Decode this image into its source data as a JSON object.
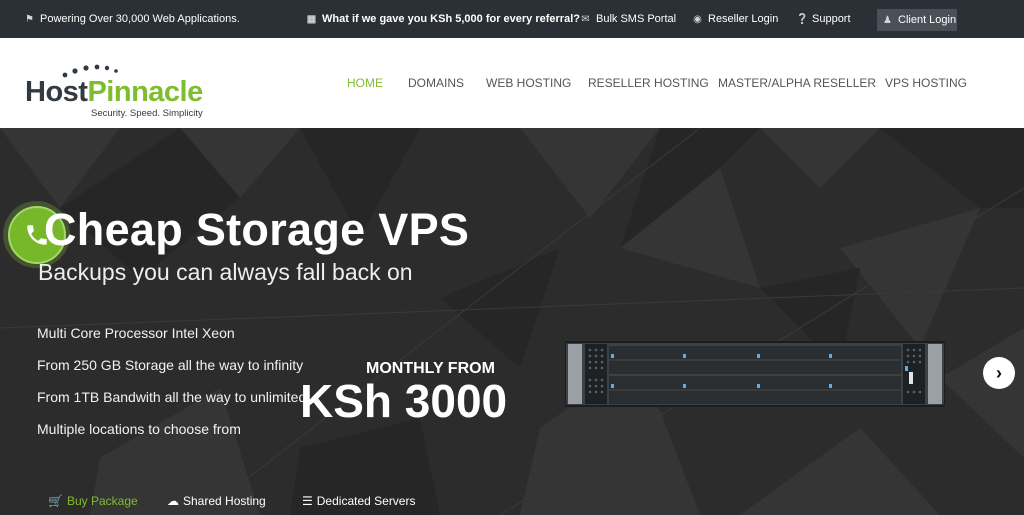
{
  "topbar": {
    "powering": "Powering Over 30,000 Web Applications.",
    "referral": "What if we gave you KSh 5,000 for every referral?",
    "sms": "Bulk SMS Portal",
    "reseller_login": "Reseller Login",
    "support": "Support",
    "client_login": "Client Login"
  },
  "logo": {
    "host": "Host",
    "pinnacle": "Pinnacle",
    "tagline": "Security. Speed. Simplicity"
  },
  "nav": [
    "HOME",
    "DOMAINS",
    "WEB HOSTING",
    "RESELLER HOSTING",
    "MASTER/ALPHA RESELLER",
    "VPS HOSTING"
  ],
  "hero": {
    "title": "Cheap Storage VPS",
    "subtitle": "Backups you can always fall back on",
    "features": [
      "Multi Core Processor Intel Xeon",
      "From 250 GB Storage all the way to infinity",
      "From 1TB Bandwith all the way to unlimited",
      "Multiple locations to choose from"
    ],
    "monthly_label": "MONTHLY FROM",
    "price": "KSh 3000"
  },
  "tabs": [
    "Buy Package",
    "Shared Hosting",
    "Dedicated Servers"
  ],
  "colors": {
    "accent": "#7fbd2e",
    "topbar": "#2b3037",
    "hero_bg": "#2c2c2c"
  },
  "icons": [
    "trophy-icon",
    "gift-icon",
    "sms-icon",
    "reseller-icon",
    "support-icon",
    "user-icon",
    "phone-icon",
    "chevron-right-icon",
    "cart-icon",
    "cloud-icon",
    "database-icon"
  ]
}
